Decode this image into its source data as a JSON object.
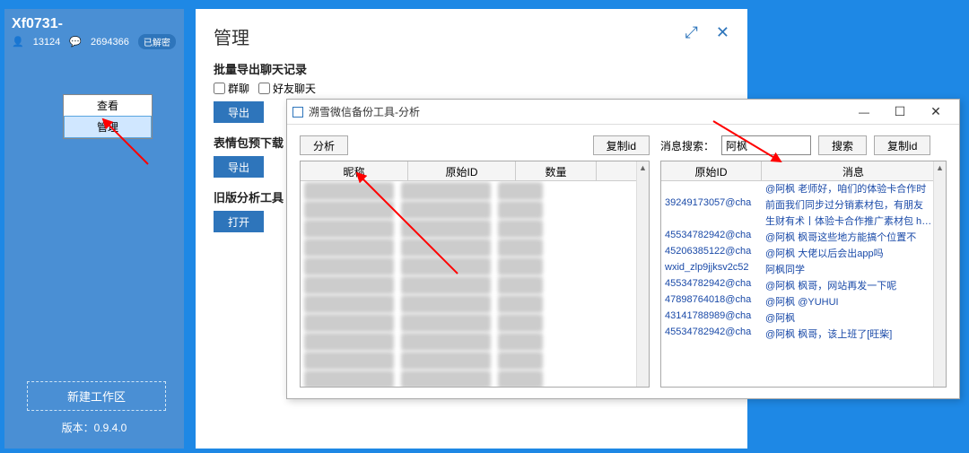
{
  "sidebar": {
    "title": "Xf0731-",
    "friends": "13124",
    "groups": "2694366",
    "pill": "已解密",
    "context_view": "查看",
    "context_manage": "管理",
    "new_workspace": "新建工作区",
    "version_label": "版本：",
    "version": "0.9.4.0"
  },
  "main": {
    "title": "管理",
    "export_chat_h": "批量导出聊天记录",
    "chk_group": "群聊",
    "chk_friend": "好友聊天",
    "btn_export": "导出",
    "sticker_h": "表情包预下载",
    "old_h": "旧版分析工具",
    "btn_open": "打开"
  },
  "titlebar": {
    "minimize": "⤢",
    "close": "✕"
  },
  "dialog": {
    "title": "溯雪微信备份工具-分析",
    "btn_analyze": "分析",
    "btn_copyid": "复制id",
    "search_lbl": "消息搜索：",
    "search_val": "阿枫",
    "btn_search": "搜索",
    "left_cols": {
      "c1": "昵称",
      "c2": "原始ID",
      "c3": "数量"
    },
    "right_cols": {
      "c1": "原始ID",
      "c2": "消息"
    },
    "rows": [
      {
        "id": "",
        "msg": "@阿枫 老师好，咱们的体验卡合作时"
      },
      {
        "id": "39249173057@cha",
        "msg": "前面我们同步过分销素材包，有朋友"
      },
      {
        "id": "",
        "msg": "生财有术丨体验卡合作推广素材包 https://i.shengcaiyoushu.com/t/E"
      },
      {
        "id": "45534782942@cha",
        "msg": "@阿枫 枫哥这些地方能搞个位置不"
      },
      {
        "id": "45206385122@cha",
        "msg": "@阿枫 大佬以后会出app吗"
      },
      {
        "id": "wxid_zlp9jjksv2c52",
        "msg": "阿枫同学"
      },
      {
        "id": "45534782942@cha",
        "msg": "@阿枫 枫哥，网站再发一下呢"
      },
      {
        "id": "47898764018@cha",
        "msg": "@阿枫 @YUHUI"
      },
      {
        "id": "43141788989@cha",
        "msg": "@阿枫"
      },
      {
        "id": "45534782942@cha",
        "msg": "@阿枫 枫哥，该上班了[旺柴]"
      }
    ]
  }
}
